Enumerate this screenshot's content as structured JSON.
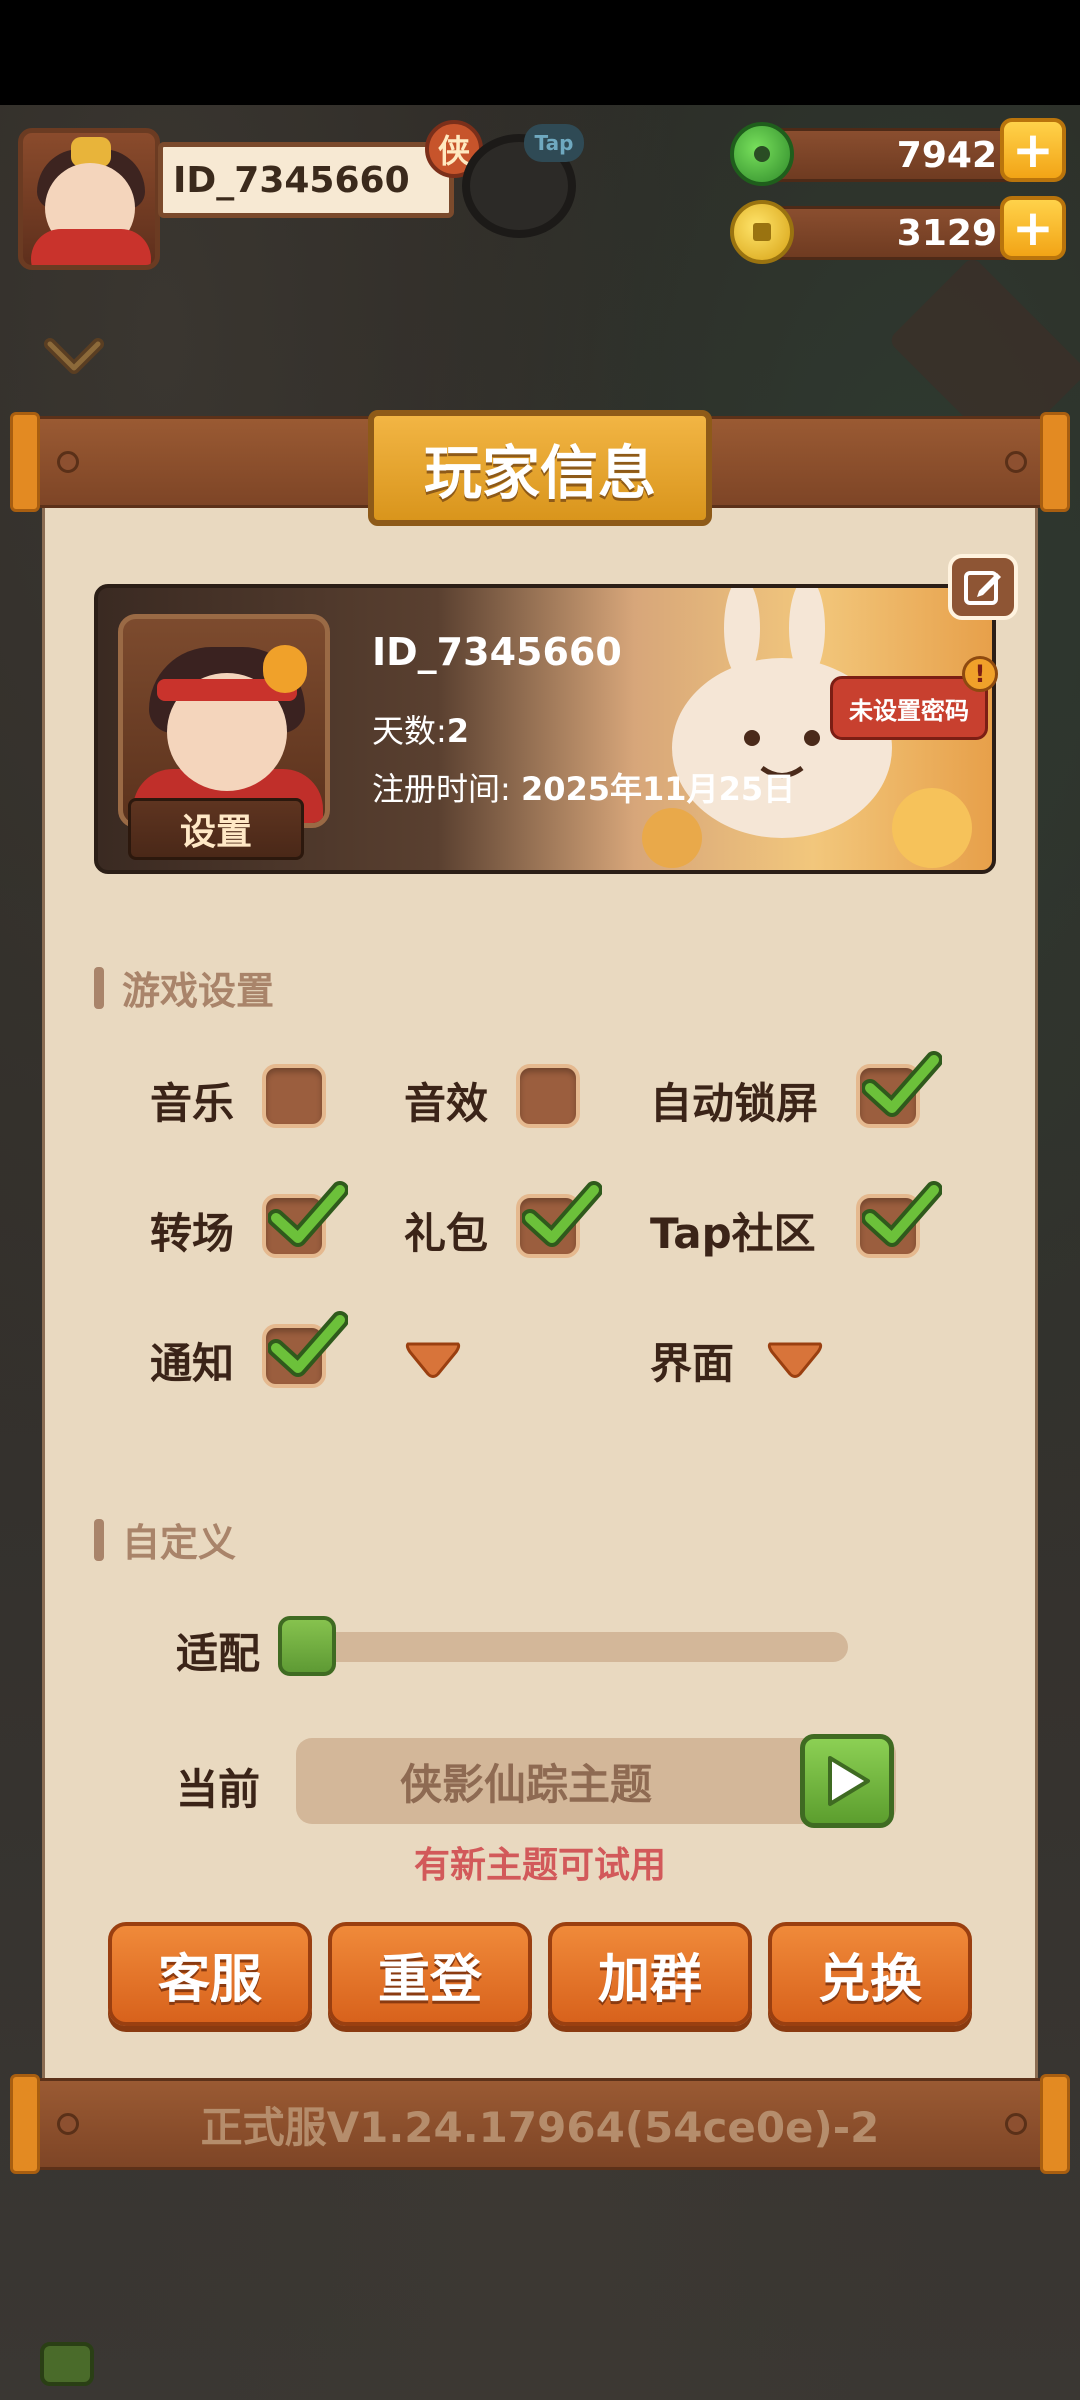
{
  "hud": {
    "player_id": "ID_7345660",
    "badge": "侠",
    "tap_tag": "Tap",
    "jade": "7942",
    "coins": "3129",
    "plus": "+"
  },
  "panel": {
    "title": "玩家信息",
    "version": "正式服V1.24.17964(54ce0e)-2"
  },
  "profile": {
    "id": "ID_7345660",
    "days_label": "天数:",
    "days_value": "2",
    "register_label": "注册时间:",
    "register_value": "2025年11月25日",
    "setting_button": "设置",
    "password_button": "未设置密码",
    "alert": "!"
  },
  "game_settings": {
    "heading": "游戏设置",
    "options": [
      {
        "label": "音乐",
        "checked": false
      },
      {
        "label": "音效",
        "checked": false
      },
      {
        "label": "自动锁屏",
        "checked": true
      },
      {
        "label": "转场",
        "checked": true
      },
      {
        "label": "礼包",
        "checked": true
      },
      {
        "label": "Tap社区",
        "checked": true
      },
      {
        "label": "通知",
        "checked": true
      },
      {
        "label": "界面",
        "checked": false
      }
    ]
  },
  "custom": {
    "heading": "自定义",
    "adapt_label": "适配",
    "adapt_level": 0,
    "current_label": "当前",
    "theme_name": "侠影仙踪主题",
    "theme_hint": "有新主题可试用"
  },
  "actions": [
    "客服",
    "重登",
    "加群",
    "兑换"
  ],
  "colors": {
    "panel_bg": "#e9d9c0",
    "accent_orange": "#e0752a",
    "check_green": "#6cc13a",
    "hint_red": "#d2595a"
  }
}
